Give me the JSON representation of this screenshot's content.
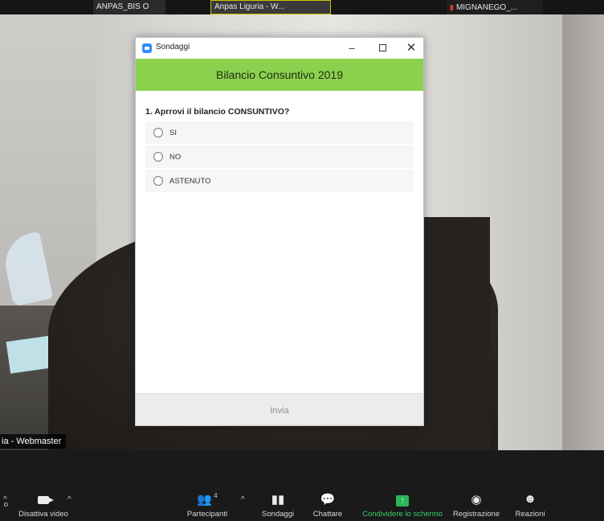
{
  "participants_strip": [
    {
      "name": "ANPAS_BIS O"
    },
    {
      "name": "Anpas Liguria - W..."
    },
    {
      "name": "MIGNANEGO_..."
    }
  ],
  "speaker_name_tag": "ia - Webmaster",
  "poll_window": {
    "app_title": "Sondaggi",
    "poll_title": "Bilancio Consuntivo 2019",
    "question": "1. Aprrovi il bilancio CONSUNTIVO?",
    "options": [
      {
        "label": "SI",
        "selected": false
      },
      {
        "label": "NO",
        "selected": false
      },
      {
        "label": "ASTENUTO",
        "selected": false
      }
    ],
    "submit_label": "Invia",
    "header_color": "#8bd14e"
  },
  "toolbar": {
    "video_label": "Disattiva video",
    "left_cut_label": "o",
    "participants_label": "Partecipanti",
    "participants_count": "4",
    "polls_label": "Sondaggi",
    "chat_label": "Chattare",
    "share_label": "Condividere lo schermo",
    "record_label": "Registrazione",
    "reactions_label": "Reazioni",
    "share_color": "#3ad06a"
  }
}
